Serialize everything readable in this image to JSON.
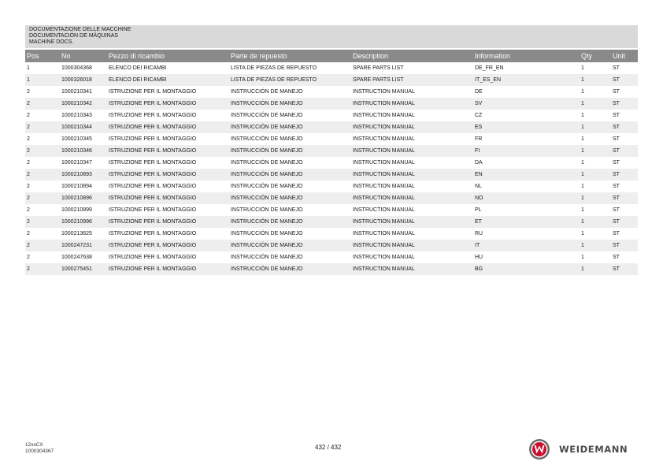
{
  "header": {
    "lines": [
      "DOCUMENTAZIONE DELLE MACCHINE",
      "DOCUMENTACIÓN DE MÁQUINAS",
      "MACHINE DOCS."
    ]
  },
  "table": {
    "columns": [
      "Pos",
      "No",
      "Pezzo di ricambio",
      "Parte de repuesto",
      "Description",
      "Information",
      "Qty",
      "Unit"
    ],
    "rows": [
      [
        "1",
        "1000304368",
        "ELENCO DEI RICAMBI",
        "LISTA DE PIEZAS DE REPUESTO",
        "SPARE PARTS LIST",
        "DE_FR_EN",
        "1",
        "ST"
      ],
      [
        "1",
        "1000326018",
        "ELENCO DEI RICAMBI",
        "LISTA DE PIEZAS DE REPUESTO",
        "SPARE PARTS LIST",
        "IT_ES_EN",
        "1",
        "ST"
      ],
      [
        "2",
        "1000210341",
        "ISTRUZIONE PER IL MONTAGGIO",
        "INSTRUCCIÓN DE MANEJO",
        "INSTRUCTION MANUAL",
        "DE",
        "1",
        "ST"
      ],
      [
        "2",
        "1000210342",
        "ISTRUZIONE PER IL MONTAGGIO",
        "INSTRUCCIÓN DE MANEJO",
        "INSTRUCTION MANUAL",
        "SV",
        "1",
        "ST"
      ],
      [
        "2",
        "1000210343",
        "ISTRUZIONE PER IL MONTAGGIO",
        "INSTRUCCIÓN DE MANEJO",
        "INSTRUCTION MANUAL",
        "CZ",
        "1",
        "ST"
      ],
      [
        "2",
        "1000210344",
        "ISTRUZIONE PER IL MONTAGGIO",
        "INSTRUCCIÓN DE MANEJO",
        "INSTRUCTION MANUAL",
        "ES",
        "1",
        "ST"
      ],
      [
        "2",
        "1000210345",
        "ISTRUZIONE PER IL MONTAGGIO",
        "INSTRUCCIÓN DE MANEJO",
        "INSTRUCTION MANUAL",
        "FR",
        "1",
        "ST"
      ],
      [
        "2",
        "1000210346",
        "ISTRUZIONE PER IL MONTAGGIO",
        "INSTRUCCIÓN DE MANEJO",
        "INSTRUCTION MANUAL",
        "FI",
        "1",
        "ST"
      ],
      [
        "2",
        "1000210347",
        "ISTRUZIONE PER IL MONTAGGIO",
        "INSTRUCCIÓN DE MANEJO",
        "INSTRUCTION MANUAL",
        "DA",
        "1",
        "ST"
      ],
      [
        "2",
        "1000210893",
        "ISTRUZIONE PER IL MONTAGGIO",
        "INSTRUCCIÓN DE MANEJO",
        "INSTRUCTION MANUAL",
        "EN",
        "1",
        "ST"
      ],
      [
        "2",
        "1000210894",
        "ISTRUZIONE PER IL MONTAGGIO",
        "INSTRUCCIÓN DE MANEJO",
        "INSTRUCTION MANUAL",
        "NL",
        "1",
        "ST"
      ],
      [
        "2",
        "1000210896",
        "ISTRUZIONE PER IL MONTAGGIO",
        "INSTRUCCIÓN DE MANEJO",
        "INSTRUCTION MANUAL",
        "NO",
        "1",
        "ST"
      ],
      [
        "2",
        "1000210899",
        "ISTRUZIONE PER IL MONTAGGIO",
        "INSTRUCCIÓN DE MANEJO",
        "INSTRUCTION MANUAL",
        "PL",
        "1",
        "ST"
      ],
      [
        "2",
        "1000210996",
        "ISTRUZIONE PER IL MONTAGGIO",
        "INSTRUCCIÓN DE MANEJO",
        "INSTRUCTION MANUAL",
        "ET",
        "1",
        "ST"
      ],
      [
        "2",
        "1000213625",
        "ISTRUZIONE PER IL MONTAGGIO",
        "INSTRUCCIÓN DE MANEJO",
        "INSTRUCTION MANUAL",
        "RU",
        "1",
        "ST"
      ],
      [
        "2",
        "1000247231",
        "ISTRUZIONE PER IL MONTAGGIO",
        "INSTRUCCIÓN DE MANEJO",
        "INSTRUCTION MANUAL",
        "IT",
        "1",
        "ST"
      ],
      [
        "2",
        "1000247638",
        "ISTRUZIONE PER IL MONTAGGIO",
        "INSTRUCCIÓN DE MANEJO",
        "INSTRUCTION MANUAL",
        "HU",
        "1",
        "ST"
      ],
      [
        "2",
        "1000275451",
        "ISTRUZIONE PER IL MONTAGGIO",
        "INSTRUCCIÓN DE MANEJO",
        "INSTRUCTION MANUAL",
        "BG",
        "1",
        "ST"
      ]
    ]
  },
  "footer": {
    "model": "12xxCX",
    "doc_number": "1000304367",
    "page": "432 / 432",
    "brand": "WEIDEMANN",
    "logo_icon": "weidemann-w-logo-icon",
    "colors": {
      "logo_red": "#c8102e",
      "logo_grey": "#6b6b6b",
      "header_bg": "#8a8a8a",
      "title_bg": "#d9d9d9"
    }
  }
}
